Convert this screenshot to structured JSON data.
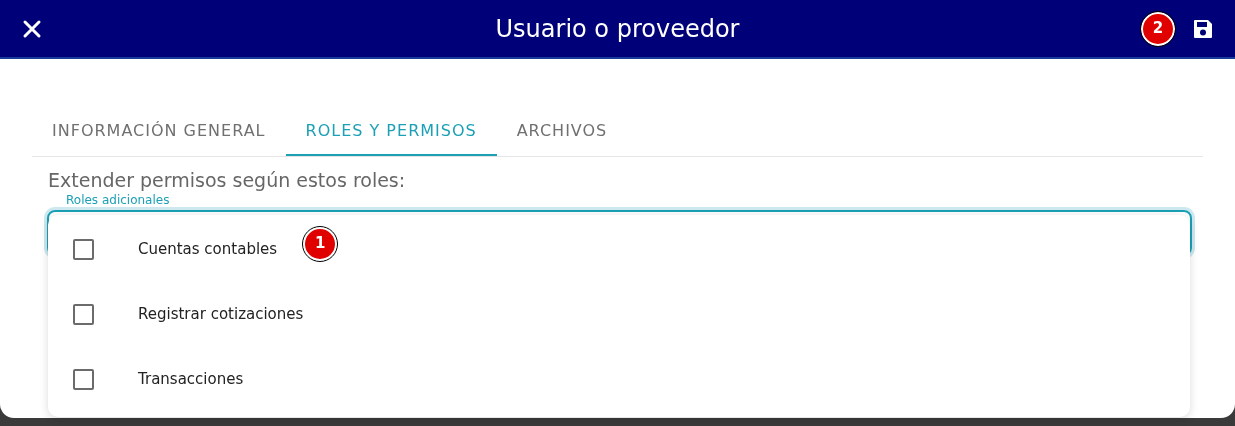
{
  "header": {
    "title": "Usuario o proveedor",
    "badge": "2"
  },
  "tabs": [
    {
      "label": "INFORMACIÓN GENERAL",
      "selected": false
    },
    {
      "label": "ROLES Y PERMISOS",
      "selected": true
    },
    {
      "label": "ARCHIVOS",
      "selected": false
    }
  ],
  "section_label": "Extender permisos según estos roles:",
  "field": {
    "label": "Roles adicionales"
  },
  "dropdown": {
    "badge": "1",
    "options": [
      {
        "label": "Cuentas contables",
        "checked": false
      },
      {
        "label": "Registrar cotizaciones",
        "checked": false
      },
      {
        "label": "Transacciones",
        "checked": false
      }
    ]
  }
}
